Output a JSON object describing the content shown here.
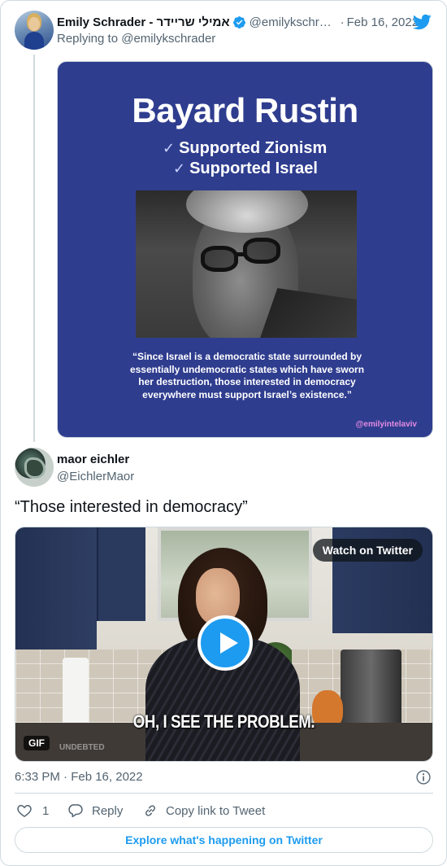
{
  "parent_tweet": {
    "author_name": "Emily Schrader - אמילי שריידר",
    "handle": "@emilykschr…",
    "separator": "·",
    "date": "Feb 16, 2022",
    "replying_to": "Replying to @emilykschrader",
    "media": {
      "title": "Bayard Rustin",
      "check_mark": "✓",
      "check_1": "Supported Zionism",
      "check_2": "Supported Israel",
      "quote": "“Since Israel is a democratic state surrounded by essentially undemocratic states which have sworn her destruction, those interested in democracy everywhere must support Israel’s existence.”",
      "credit": "@emilyintelaviv",
      "background_color": "#2f3d8f"
    }
  },
  "reply_tweet": {
    "author_name": "maor eichler",
    "handle": "@EichlerMaor",
    "text": "“Those interested in democracy”",
    "media": {
      "watch_label": "Watch on Twitter",
      "caption": "OH, I SEE THE PROBLEM.",
      "gif_badge": "GIF",
      "watermark": "UNDEBTED",
      "play_icon": "play-icon"
    },
    "timestamp": "6:33 PM · Feb 16, 2022",
    "actions": {
      "like_count": "1",
      "reply_label": "Reply",
      "copy_label": "Copy link to Tweet"
    }
  },
  "explore_label": "Explore what's happening on Twitter",
  "colors": {
    "accent": "#1d9bf0",
    "text_primary": "#0f1419",
    "text_secondary": "#536471",
    "border": "#cfd9de"
  }
}
